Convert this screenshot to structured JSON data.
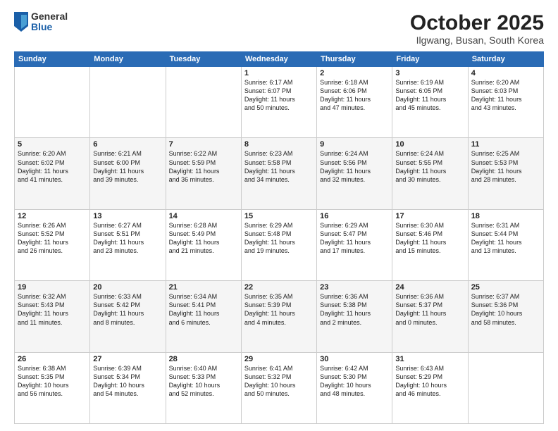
{
  "header": {
    "logo_general": "General",
    "logo_blue": "Blue",
    "month_title": "October 2025",
    "location": "Ilgwang, Busan, South Korea"
  },
  "days_of_week": [
    "Sunday",
    "Monday",
    "Tuesday",
    "Wednesday",
    "Thursday",
    "Friday",
    "Saturday"
  ],
  "weeks": [
    [
      {
        "day": "",
        "info": ""
      },
      {
        "day": "",
        "info": ""
      },
      {
        "day": "",
        "info": ""
      },
      {
        "day": "1",
        "info": "Sunrise: 6:17 AM\nSunset: 6:07 PM\nDaylight: 11 hours\nand 50 minutes."
      },
      {
        "day": "2",
        "info": "Sunrise: 6:18 AM\nSunset: 6:06 PM\nDaylight: 11 hours\nand 47 minutes."
      },
      {
        "day": "3",
        "info": "Sunrise: 6:19 AM\nSunset: 6:05 PM\nDaylight: 11 hours\nand 45 minutes."
      },
      {
        "day": "4",
        "info": "Sunrise: 6:20 AM\nSunset: 6:03 PM\nDaylight: 11 hours\nand 43 minutes."
      }
    ],
    [
      {
        "day": "5",
        "info": "Sunrise: 6:20 AM\nSunset: 6:02 PM\nDaylight: 11 hours\nand 41 minutes."
      },
      {
        "day": "6",
        "info": "Sunrise: 6:21 AM\nSunset: 6:00 PM\nDaylight: 11 hours\nand 39 minutes."
      },
      {
        "day": "7",
        "info": "Sunrise: 6:22 AM\nSunset: 5:59 PM\nDaylight: 11 hours\nand 36 minutes."
      },
      {
        "day": "8",
        "info": "Sunrise: 6:23 AM\nSunset: 5:58 PM\nDaylight: 11 hours\nand 34 minutes."
      },
      {
        "day": "9",
        "info": "Sunrise: 6:24 AM\nSunset: 5:56 PM\nDaylight: 11 hours\nand 32 minutes."
      },
      {
        "day": "10",
        "info": "Sunrise: 6:24 AM\nSunset: 5:55 PM\nDaylight: 11 hours\nand 30 minutes."
      },
      {
        "day": "11",
        "info": "Sunrise: 6:25 AM\nSunset: 5:53 PM\nDaylight: 11 hours\nand 28 minutes."
      }
    ],
    [
      {
        "day": "12",
        "info": "Sunrise: 6:26 AM\nSunset: 5:52 PM\nDaylight: 11 hours\nand 26 minutes."
      },
      {
        "day": "13",
        "info": "Sunrise: 6:27 AM\nSunset: 5:51 PM\nDaylight: 11 hours\nand 23 minutes."
      },
      {
        "day": "14",
        "info": "Sunrise: 6:28 AM\nSunset: 5:49 PM\nDaylight: 11 hours\nand 21 minutes."
      },
      {
        "day": "15",
        "info": "Sunrise: 6:29 AM\nSunset: 5:48 PM\nDaylight: 11 hours\nand 19 minutes."
      },
      {
        "day": "16",
        "info": "Sunrise: 6:29 AM\nSunset: 5:47 PM\nDaylight: 11 hours\nand 17 minutes."
      },
      {
        "day": "17",
        "info": "Sunrise: 6:30 AM\nSunset: 5:46 PM\nDaylight: 11 hours\nand 15 minutes."
      },
      {
        "day": "18",
        "info": "Sunrise: 6:31 AM\nSunset: 5:44 PM\nDaylight: 11 hours\nand 13 minutes."
      }
    ],
    [
      {
        "day": "19",
        "info": "Sunrise: 6:32 AM\nSunset: 5:43 PM\nDaylight: 11 hours\nand 11 minutes."
      },
      {
        "day": "20",
        "info": "Sunrise: 6:33 AM\nSunset: 5:42 PM\nDaylight: 11 hours\nand 8 minutes."
      },
      {
        "day": "21",
        "info": "Sunrise: 6:34 AM\nSunset: 5:41 PM\nDaylight: 11 hours\nand 6 minutes."
      },
      {
        "day": "22",
        "info": "Sunrise: 6:35 AM\nSunset: 5:39 PM\nDaylight: 11 hours\nand 4 minutes."
      },
      {
        "day": "23",
        "info": "Sunrise: 6:36 AM\nSunset: 5:38 PM\nDaylight: 11 hours\nand 2 minutes."
      },
      {
        "day": "24",
        "info": "Sunrise: 6:36 AM\nSunset: 5:37 PM\nDaylight: 11 hours\nand 0 minutes."
      },
      {
        "day": "25",
        "info": "Sunrise: 6:37 AM\nSunset: 5:36 PM\nDaylight: 10 hours\nand 58 minutes."
      }
    ],
    [
      {
        "day": "26",
        "info": "Sunrise: 6:38 AM\nSunset: 5:35 PM\nDaylight: 10 hours\nand 56 minutes."
      },
      {
        "day": "27",
        "info": "Sunrise: 6:39 AM\nSunset: 5:34 PM\nDaylight: 10 hours\nand 54 minutes."
      },
      {
        "day": "28",
        "info": "Sunrise: 6:40 AM\nSunset: 5:33 PM\nDaylight: 10 hours\nand 52 minutes."
      },
      {
        "day": "29",
        "info": "Sunrise: 6:41 AM\nSunset: 5:32 PM\nDaylight: 10 hours\nand 50 minutes."
      },
      {
        "day": "30",
        "info": "Sunrise: 6:42 AM\nSunset: 5:30 PM\nDaylight: 10 hours\nand 48 minutes."
      },
      {
        "day": "31",
        "info": "Sunrise: 6:43 AM\nSunset: 5:29 PM\nDaylight: 10 hours\nand 46 minutes."
      },
      {
        "day": "",
        "info": ""
      }
    ]
  ]
}
